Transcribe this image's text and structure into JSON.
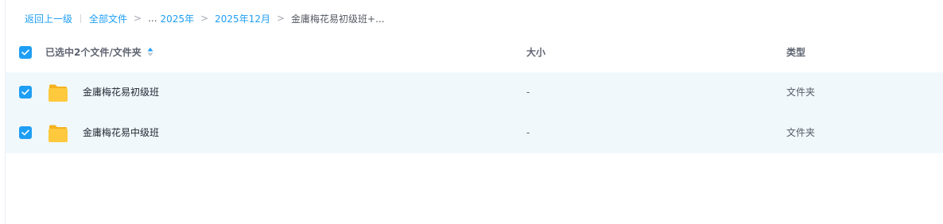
{
  "breadcrumb": {
    "back_label": "返回上一级",
    "root_label": "全部文件",
    "sep": ">",
    "ellipsis": "...",
    "level1": "2025年",
    "level2": "2025年12月",
    "current": "金庸梅花易初级班+..."
  },
  "header": {
    "selected_label": "已选中2个文件/文件夹",
    "size_label": "大小",
    "type_label": "类型"
  },
  "files": [
    {
      "name": "金庸梅花易初级班",
      "size": "-",
      "type": "文件夹",
      "checked": true
    },
    {
      "name": "金庸梅花易中级班",
      "size": "-",
      "type": "文件夹",
      "checked": true
    }
  ],
  "colors": {
    "accent": "#1e9ef4",
    "row_selected_bg": "#f0f8fc",
    "folder": "#ffc93d"
  },
  "icons": {
    "checkbox": "checkmark-icon",
    "sort": "sort-icon",
    "folder": "folder-icon"
  }
}
